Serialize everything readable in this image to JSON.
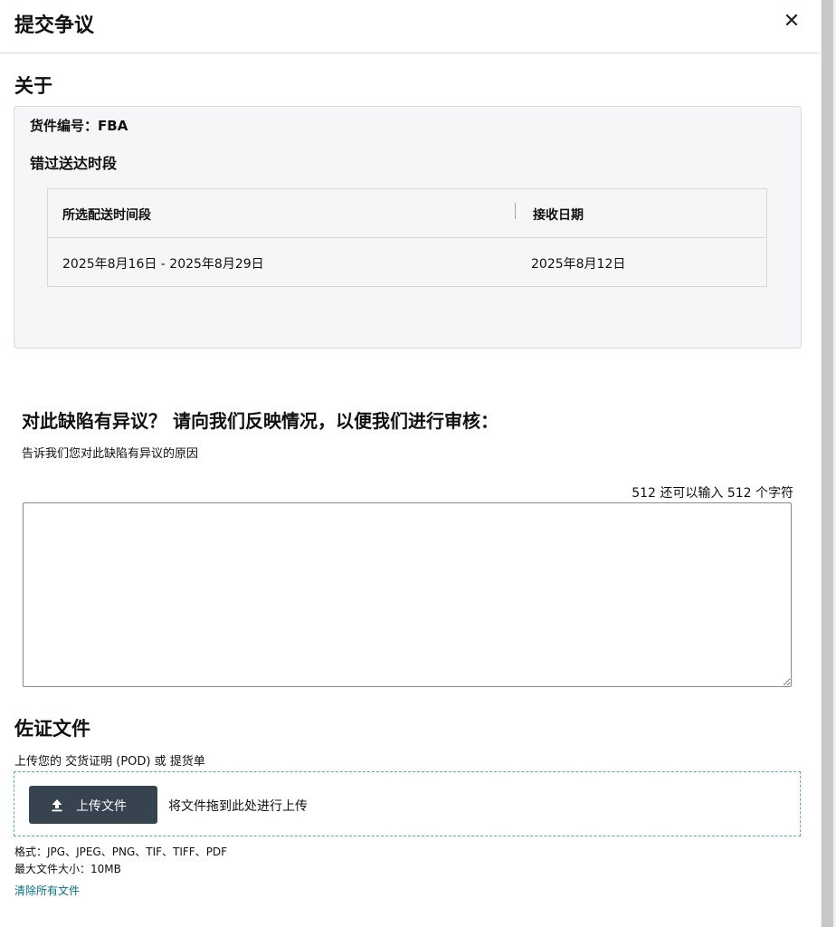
{
  "dialog": {
    "title": "提交争议",
    "close_glyph": "✕"
  },
  "about": {
    "title": "关于",
    "shipment_label": "货件编号：",
    "shipment_id_visible": "FBA",
    "issue_type": "错过送达时段",
    "table": {
      "headers": [
        "所选配送时间段",
        "接收日期"
      ],
      "rows": [
        [
          "2025年8月16日 - 2025年8月29日",
          "2025年8月12日"
        ]
      ]
    }
  },
  "dispute": {
    "heading": "对此缺陷有异议？ 请向我们反映情况，以便我们进行审核：",
    "subtext": "告诉我们您对此缺陷有异议的原因",
    "char_counter": "512 还可以输入 512 个字符",
    "reason_value": ""
  },
  "evidence": {
    "title": "佐证文件",
    "subtitle": "上传您的 交货证明 (POD) 或 提货单",
    "upload_button": "上传文件",
    "drop_hint": "将文件拖到此处进行上传",
    "formats": "格式：JPG、JPEG、PNG、TIF、TIFF、PDF",
    "max_size": "最大文件大小：10MB",
    "clear_link": "清除所有文件"
  },
  "colors": {
    "card_bg": "#f6f6f8",
    "button_bg": "#37444f",
    "link": "#007185",
    "dropzone_border": "#58aab8"
  },
  "icons": [
    "close-icon",
    "upload-icon"
  ]
}
